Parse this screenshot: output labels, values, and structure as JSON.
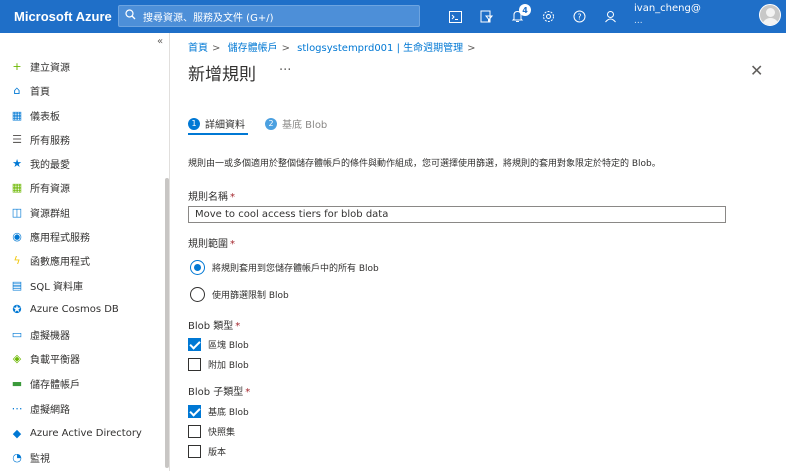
{
  "topbar": {
    "brand": "Microsoft Azure",
    "search_placeholder": "搜尋資源、服務及文件 (G+/)",
    "notification_count": "4",
    "user_name": "ivan_cheng@",
    "user_org": "..."
  },
  "sidebar": {
    "collapse": "«",
    "items": [
      {
        "label": "建立資源",
        "icon": "plus-icon",
        "color": "#6bb700"
      },
      {
        "label": "首頁",
        "icon": "home-icon",
        "color": "#0078d4"
      },
      {
        "label": "儀表板",
        "icon": "dashboard-icon",
        "color": "#0078d4"
      },
      {
        "label": "所有服務",
        "icon": "list-icon",
        "color": "#605e5c"
      },
      {
        "label": "我的最愛",
        "icon": "star-icon",
        "color": "#0078d4"
      },
      {
        "label": "所有資源",
        "icon": "grid-icon",
        "color": "#6bb700"
      },
      {
        "label": "資源群組",
        "icon": "resource-group-icon",
        "color": "#0078d4"
      },
      {
        "label": "應用程式服務",
        "icon": "app-service-icon",
        "color": "#0078d4"
      },
      {
        "label": "函數應用程式",
        "icon": "function-icon",
        "color": "#f2c811"
      },
      {
        "label": "SQL 資料庫",
        "icon": "sql-icon",
        "color": "#0078d4"
      },
      {
        "label": "Azure Cosmos DB",
        "icon": "cosmos-icon",
        "color": "#0078d4"
      },
      {
        "label": "虛擬機器",
        "icon": "vm-icon",
        "color": "#0078d4"
      },
      {
        "label": "負載平衡器",
        "icon": "load-balancer-icon",
        "color": "#6bb700"
      },
      {
        "label": "儲存體帳戶",
        "icon": "storage-icon",
        "color": "#3a9a3a"
      },
      {
        "label": "虛擬網路",
        "icon": "vnet-icon",
        "color": "#0078d4"
      },
      {
        "label": "Azure Active Directory",
        "icon": "aad-icon",
        "color": "#0078d4"
      },
      {
        "label": "監視",
        "icon": "monitor-icon",
        "color": "#0078d4"
      }
    ]
  },
  "main": {
    "breadcrumb": [
      "首頁",
      "儲存體帳戶",
      "stlogsystemprd001 | 生命週期管理"
    ],
    "title": "新增規則",
    "more": "···",
    "close": "✕",
    "steps": [
      {
        "num": "1",
        "label": "詳細資料"
      },
      {
        "num": "2",
        "label": "基底 Blob"
      }
    ],
    "description": "規則由一或多個適用於整個儲存體帳戶的條件與動作組成，您可選擇使用篩選，將規則的套用對象限定於特定的 Blob。",
    "rule_name_label": "規則名稱",
    "rule_name_value": "Move to cool access tiers for blob data",
    "rule_scope_label": "規則範圍",
    "scope_options": [
      "將規則套用到您儲存體帳戶中的所有 Blob",
      "使用篩選限制 Blob"
    ],
    "blob_type_label": "Blob 類型",
    "blob_types": [
      "區塊 Blob",
      "附加 Blob"
    ],
    "blob_subtype_label": "Blob 子類型",
    "blob_subtypes": [
      "基底 Blob",
      "快照集",
      "版本"
    ],
    "required_mark": "*"
  },
  "colors": {
    "topbar": "#1f6fc8",
    "accent": "#0078d4"
  }
}
